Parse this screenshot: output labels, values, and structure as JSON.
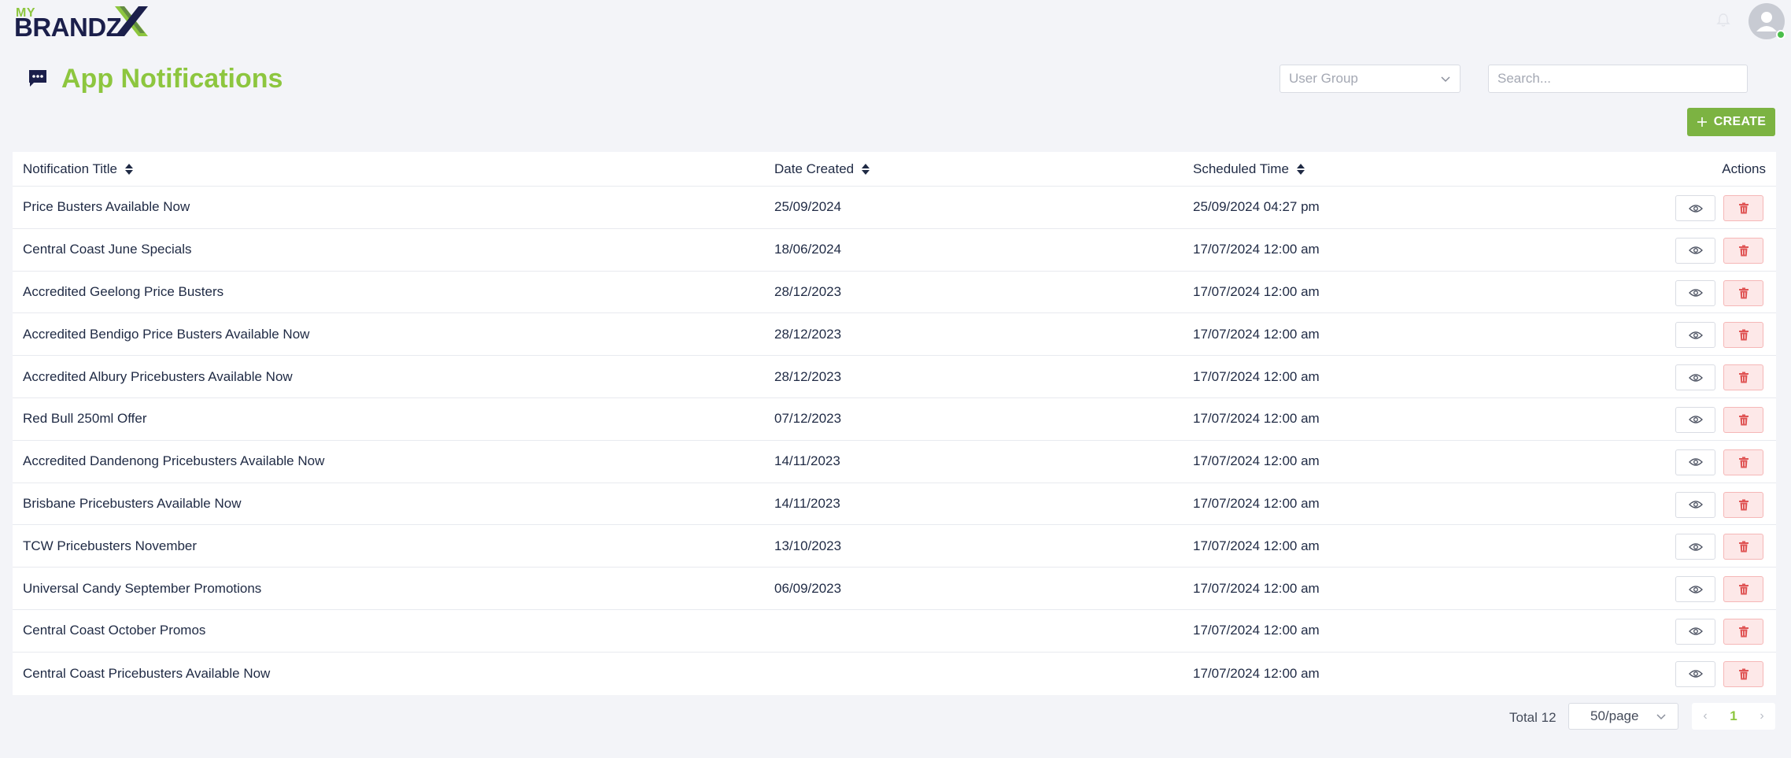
{
  "brand": {
    "my": "MY",
    "name": "BRANDZ",
    "x": "X"
  },
  "page": {
    "title": "App Notifications"
  },
  "filters": {
    "user_group_placeholder": "User Group",
    "search_placeholder": "Search..."
  },
  "toolbar": {
    "create_label": "CREATE"
  },
  "table": {
    "headers": {
      "title": "Notification Title",
      "date_created": "Date Created",
      "scheduled_time": "Scheduled Time",
      "actions": "Actions"
    },
    "rows": [
      {
        "title": "Price Busters Available Now",
        "date_created": "25/09/2024",
        "scheduled_time": "25/09/2024 04:27 pm"
      },
      {
        "title": "Central Coast June Specials",
        "date_created": "18/06/2024",
        "scheduled_time": "17/07/2024 12:00 am"
      },
      {
        "title": "Accredited Geelong Price Busters",
        "date_created": "28/12/2023",
        "scheduled_time": "17/07/2024 12:00 am"
      },
      {
        "title": "Accredited Bendigo Price Busters Available Now",
        "date_created": "28/12/2023",
        "scheduled_time": "17/07/2024 12:00 am"
      },
      {
        "title": "Accredited Albury Pricebusters Available Now",
        "date_created": "28/12/2023",
        "scheduled_time": "17/07/2024 12:00 am"
      },
      {
        "title": "Red Bull 250ml Offer",
        "date_created": "07/12/2023",
        "scheduled_time": "17/07/2024 12:00 am"
      },
      {
        "title": "Accredited Dandenong Pricebusters Available Now",
        "date_created": "14/11/2023",
        "scheduled_time": "17/07/2024 12:00 am"
      },
      {
        "title": "Brisbane Pricebusters Available Now",
        "date_created": "14/11/2023",
        "scheduled_time": "17/07/2024 12:00 am"
      },
      {
        "title": "TCW Pricebusters November",
        "date_created": "13/10/2023",
        "scheduled_time": "17/07/2024 12:00 am"
      },
      {
        "title": "Universal Candy September Promotions",
        "date_created": "06/09/2023",
        "scheduled_time": "17/07/2024 12:00 am"
      },
      {
        "title": "Central Coast October Promos",
        "date_created": "",
        "scheduled_time": "17/07/2024 12:00 am"
      },
      {
        "title": "Central Coast Pricebusters Available Now",
        "date_created": "",
        "scheduled_time": "17/07/2024 12:00 am"
      }
    ]
  },
  "pagination": {
    "total_label": "Total 12",
    "page_size": "50/page",
    "current_page": "1"
  },
  "colors": {
    "brand_green": "#8dc63f",
    "create_green": "#7cb342",
    "navy": "#1b1f4b",
    "danger_red": "#e05555",
    "online": "#4bbf4b"
  },
  "icons": {
    "title": "chat-bubble-icon",
    "view": "eye-icon",
    "delete": "trash-icon",
    "dropdown": "chevron-down-icon",
    "create": "plus-icon",
    "notifications": "bell-icon",
    "avatar": "user-icon"
  }
}
